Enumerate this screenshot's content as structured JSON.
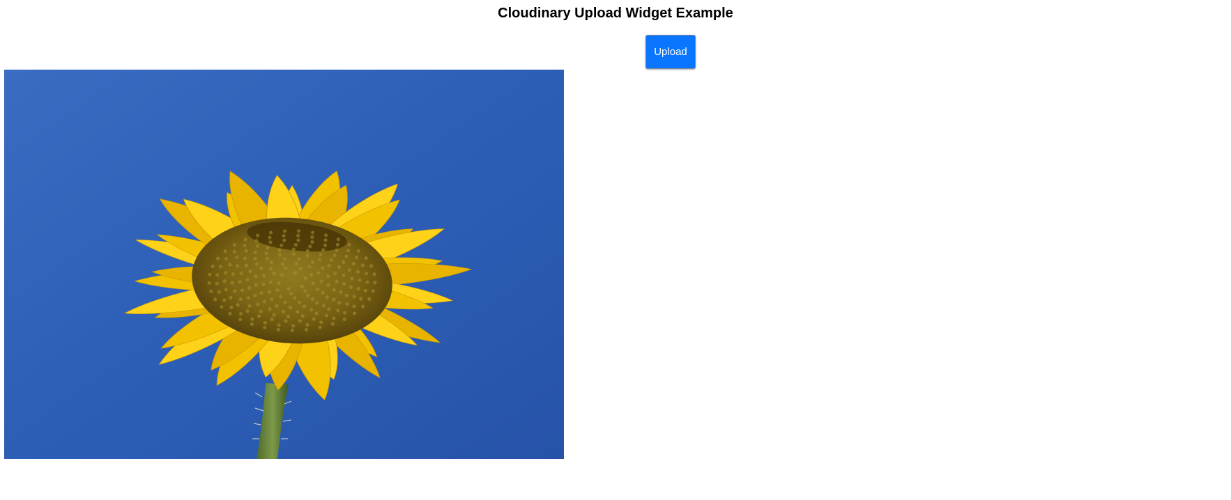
{
  "page": {
    "title": "Cloudinary Upload Widget Example"
  },
  "upload_button": {
    "label": "Upload",
    "color": "#0a76ff"
  },
  "image": {
    "subject": "sunflower against blue sky",
    "sky_color": "#2e5fb8",
    "petal_color": "#f5c800",
    "center_color": "#7a6410"
  }
}
